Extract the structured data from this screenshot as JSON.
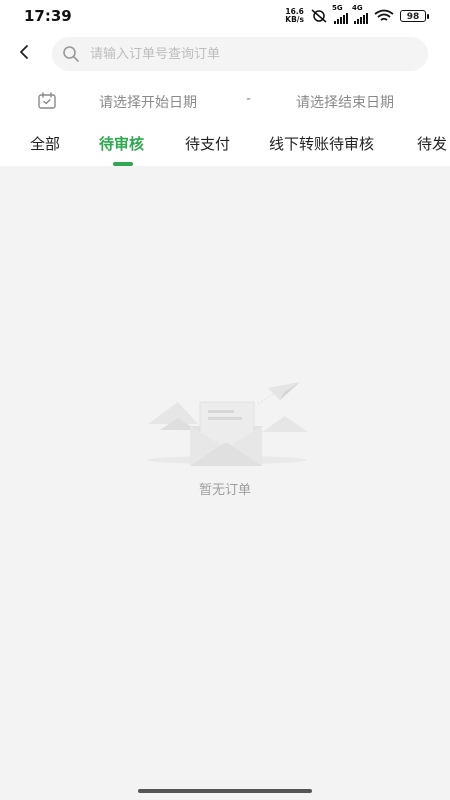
{
  "status_bar": {
    "time": "17:39",
    "net_speed_value": "16.6",
    "net_speed_unit": "KB/s",
    "signal1_label": "5G",
    "signal2_label": "4G",
    "battery": "98"
  },
  "header": {
    "back_icon": "chevron-left-icon",
    "search_icon": "search-icon",
    "search_placeholder": "请输入订单号查询订单",
    "search_value": ""
  },
  "date_filter": {
    "calendar_icon": "calendar-icon",
    "start_placeholder": "请选择开始日期",
    "separator": "-",
    "end_placeholder": "请选择结束日期"
  },
  "tabs": {
    "items": [
      {
        "label": "全部"
      },
      {
        "label": "待审核"
      },
      {
        "label": "待支付"
      },
      {
        "label": "线下转账待审核"
      },
      {
        "label": "待发"
      }
    ],
    "active_index": 1,
    "accent_color": "#2fa84f"
  },
  "empty_state": {
    "illustration_icon": "empty-envelope-icon",
    "text": "暂无订单"
  }
}
